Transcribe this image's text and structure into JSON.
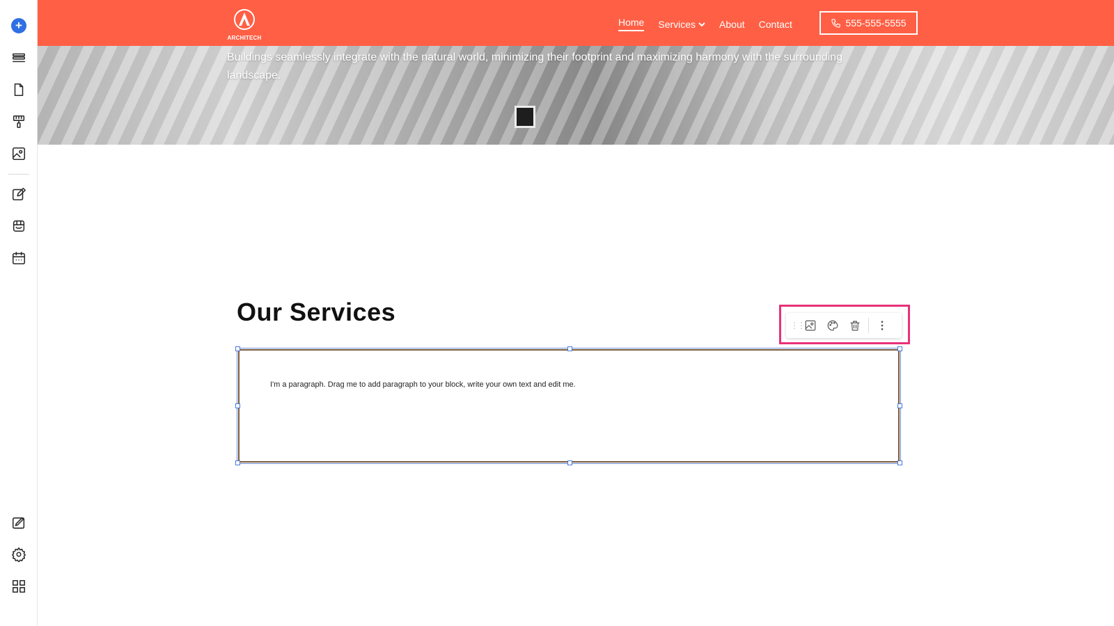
{
  "sidebar": {
    "items": [
      {
        "name": "add",
        "icon": "plus-icon"
      },
      {
        "name": "sections",
        "icon": "layers-icon"
      },
      {
        "name": "pages",
        "icon": "page-icon"
      },
      {
        "name": "design",
        "icon": "paint-roller-icon"
      },
      {
        "name": "media",
        "icon": "image-icon"
      },
      {
        "name": "blog",
        "icon": "edit-icon"
      },
      {
        "name": "store",
        "icon": "store-icon"
      },
      {
        "name": "bookings",
        "icon": "calendar-icon"
      },
      {
        "name": "marketing",
        "icon": "edit-board-icon"
      },
      {
        "name": "settings",
        "icon": "gear-icon"
      },
      {
        "name": "apps",
        "icon": "apps-icon"
      }
    ]
  },
  "header": {
    "logo_text": "ARCHITECH",
    "nav": [
      {
        "label": "Home",
        "active": true
      },
      {
        "label": "Services",
        "has_dropdown": true
      },
      {
        "label": "About"
      },
      {
        "label": "Contact"
      }
    ],
    "phone": "555-555-5555"
  },
  "hero": {
    "text": "Buildings seamlessly integrate with the natural world, minimizing their footprint and maximizing harmony with the surrounding landscape."
  },
  "services": {
    "title": "Our Services",
    "paragraph": "I'm a paragraph. Drag me to add paragraph to your block, write your own text and edit me."
  },
  "toolbar": {
    "buttons": [
      "drag-handle-icon",
      "image-icon",
      "palette-icon",
      "trash-icon",
      "more-vertical-icon"
    ]
  },
  "colors": {
    "header_bg": "#ff5f45",
    "accent_blue": "#2f6fe4",
    "highlight": "#e8317a"
  }
}
